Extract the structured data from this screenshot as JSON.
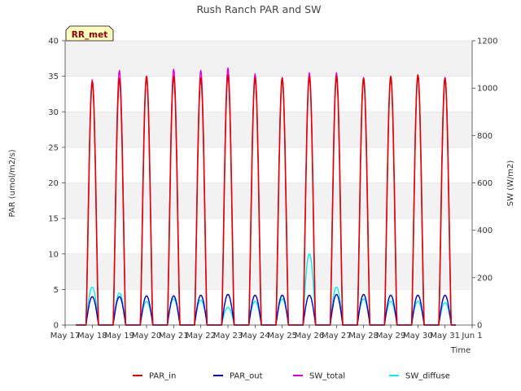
{
  "chart_data": {
    "type": "line",
    "title": "Rush Ranch PAR and SW",
    "xlabel": "Time",
    "ylabel_left": "PAR (umol/m2/s)",
    "ylabel_right": "SW (W/m2)",
    "badge": "RR_met",
    "xlim": [
      0,
      15
    ],
    "ylim_left": [
      0,
      40
    ],
    "ylim_right": [
      0,
      1200
    ],
    "x_ticks": [
      0,
      1,
      2,
      3,
      4,
      5,
      6,
      7,
      8,
      9,
      10,
      11,
      12,
      13,
      14,
      15
    ],
    "x_tick_labels": [
      "May 17",
      "May 18",
      "May 19",
      "May 20",
      "May 21",
      "May 22",
      "May 23",
      "May 24",
      "May 25",
      "May 26",
      "May 27",
      "May 28",
      "May 29",
      "May 30",
      "May 31",
      "Jun 1"
    ],
    "y_left_ticks": [
      0,
      5,
      10,
      15,
      20,
      25,
      30,
      35,
      40
    ],
    "y_right_ticks": [
      0,
      200,
      400,
      600,
      800,
      1000,
      1200
    ],
    "grid": "horizontal-bands",
    "legend_position": "bottom",
    "days": [
      "May 17",
      "May 18",
      "May 19",
      "May 20",
      "May 21",
      "May 22",
      "May 23",
      "May 24",
      "May 25",
      "May 26",
      "May 27",
      "May 28",
      "May 29",
      "May 30",
      "May 31"
    ],
    "series": [
      {
        "name": "PAR_in",
        "color": "#dd0000",
        "axis": "left",
        "daily_peak": [
          34.2,
          34.7,
          35.0,
          35.0,
          34.8,
          35.2,
          34.8,
          34.7,
          35.0,
          35.0,
          34.7,
          35.0,
          35.2,
          34.7
        ]
      },
      {
        "name": "PAR_out",
        "color": "#0000bb",
        "axis": "left",
        "daily_peak": [
          4.0,
          4.0,
          4.1,
          4.1,
          4.2,
          4.3,
          4.2,
          4.2,
          4.2,
          4.3,
          4.3,
          4.2,
          4.2,
          4.2
        ]
      },
      {
        "name": "SW_total",
        "color": "#dd00dd",
        "axis": "right",
        "daily_peak": [
          1035,
          1075,
          1050,
          1080,
          1075,
          1085,
          1060,
          1045,
          1065,
          1065,
          1045,
          1050,
          1055,
          1045
        ]
      },
      {
        "name": "SW_diffuse",
        "color": "#00eeee",
        "axis": "right",
        "daily_peak": [
          160,
          135,
          100,
          110,
          105,
          75,
          100,
          110,
          300,
          160,
          110,
          100,
          100,
          95
        ]
      }
    ]
  }
}
